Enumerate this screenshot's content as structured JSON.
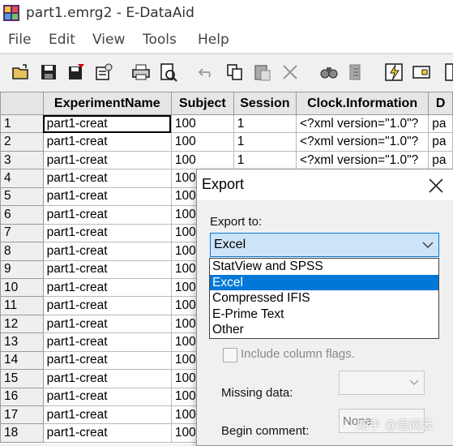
{
  "window": {
    "title": "part1.emrg2 - E-DataAid"
  },
  "menu": [
    "File",
    "Edit",
    "View",
    "Tools",
    "Help"
  ],
  "toolbar": {
    "icons": [
      "open-icon",
      "save-icon",
      "save-as-icon",
      "properties-icon",
      "print-icon",
      "print-preview-icon",
      "undo-icon",
      "copy-icon",
      "paste-icon",
      "delete-icon",
      "find-icon",
      "replace-icon",
      "analyze-icon",
      "arrange-icon",
      "more-icon"
    ]
  },
  "grid": {
    "columns": [
      "",
      "ExperimentName",
      "Subject",
      "Session",
      "Clock.Information",
      "D"
    ],
    "rows": [
      [
        "1",
        "part1-creat",
        "100",
        "1",
        "<?xml version=\"1.0\"?",
        "pa"
      ],
      [
        "2",
        "part1-creat",
        "100",
        "1",
        "<?xml version=\"1.0\"?",
        "pa"
      ],
      [
        "3",
        "part1-creat",
        "100",
        "1",
        "<?xml version=\"1.0\"?",
        "pa"
      ],
      [
        "4",
        "part1-creat",
        "100",
        "",
        "",
        ""
      ],
      [
        "5",
        "part1-creat",
        "100",
        "",
        "",
        ""
      ],
      [
        "6",
        "part1-creat",
        "100",
        "",
        "",
        ""
      ],
      [
        "7",
        "part1-creat",
        "100",
        "",
        "",
        ""
      ],
      [
        "8",
        "part1-creat",
        "100",
        "",
        "",
        ""
      ],
      [
        "9",
        "part1-creat",
        "100",
        "",
        "",
        ""
      ],
      [
        "10",
        "part1-creat",
        "100",
        "",
        "",
        ""
      ],
      [
        "11",
        "part1-creat",
        "100",
        "",
        "",
        ""
      ],
      [
        "12",
        "part1-creat",
        "100",
        "",
        "",
        ""
      ],
      [
        "13",
        "part1-creat",
        "100",
        "",
        "",
        ""
      ],
      [
        "14",
        "part1-creat",
        "100",
        "",
        "",
        ""
      ],
      [
        "15",
        "part1-creat",
        "100",
        "",
        "",
        ""
      ],
      [
        "16",
        "part1-creat",
        "100",
        "",
        "",
        ""
      ],
      [
        "17",
        "part1-creat",
        "100",
        "",
        "",
        ""
      ],
      [
        "18",
        "part1-creat",
        "100",
        "",
        "",
        ""
      ]
    ]
  },
  "dialog": {
    "title": "Export",
    "export_to_label": "Export to:",
    "export_to_value": "Excel",
    "options": [
      "StatView and SPSS",
      "Excel",
      "Compressed IFIS",
      "E-Prime Text",
      "Other"
    ],
    "selected_option": "Excel",
    "include_flags_label": "Include column flags.",
    "missing_data_label": "Missing data:",
    "missing_data_value": "",
    "begin_comment_label": "Begin comment:",
    "begin_comment_value": "None"
  },
  "watermark": "知乎 @壹网云"
}
